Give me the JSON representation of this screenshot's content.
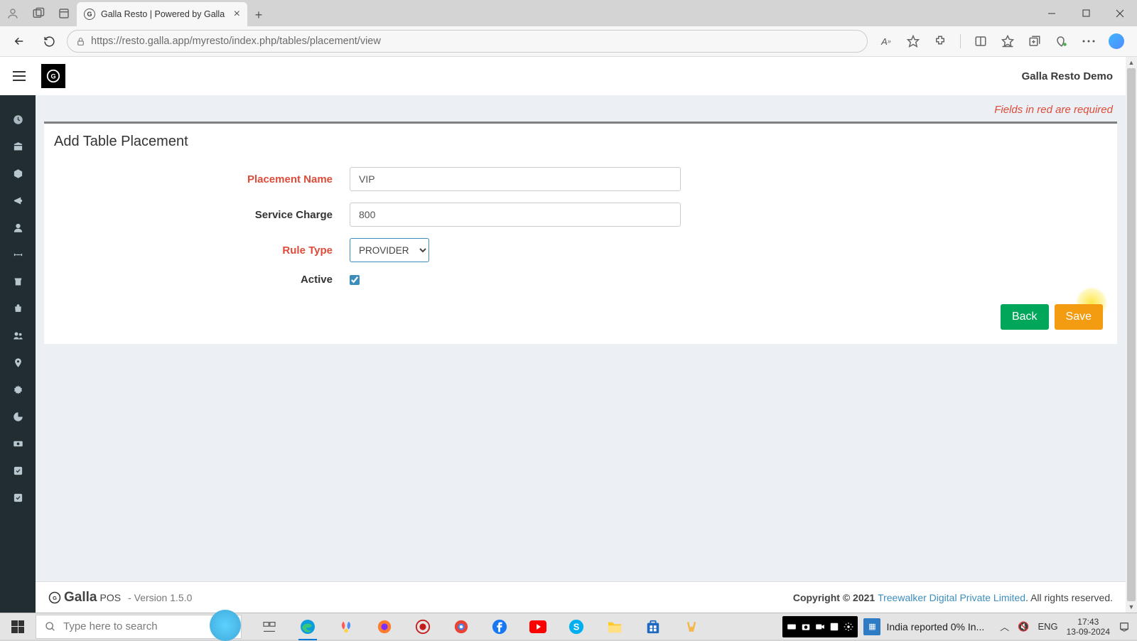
{
  "browser": {
    "tab_title": "Galla Resto | Powered by Galla",
    "url": "https://resto.galla.app/myresto/index.php/tables/placement/view"
  },
  "header": {
    "restaurant_name": "Galla Resto Demo"
  },
  "notice": "Fields in red are required",
  "form": {
    "title": "Add Table Placement",
    "labels": {
      "placement_name": "Placement Name",
      "service_charge": "Service Charge",
      "rule_type": "Rule Type",
      "active": "Active"
    },
    "values": {
      "placement_name": "VIP",
      "service_charge": "800",
      "rule_type": "PROVIDER",
      "active": true
    },
    "buttons": {
      "back": "Back",
      "save": "Save"
    }
  },
  "footer": {
    "brand": "Galla",
    "brand_suffix": "POS",
    "version_label": "Version",
    "version": "1.5.0",
    "copyright_pre": "Copyright © 2021 ",
    "company": "Treewalker Digital Private Limited",
    "copyright_post": ". All rights reserved."
  },
  "taskbar": {
    "search_placeholder": "Type here to search",
    "news": "India reported 0% In...",
    "lang": "ENG",
    "time": "17:43",
    "date": "13-09-2024"
  }
}
